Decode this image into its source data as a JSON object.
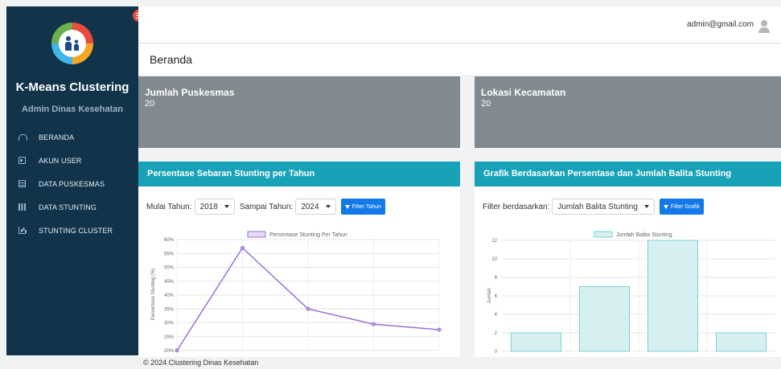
{
  "sidebar": {
    "brand_title": "K-Means Clustering",
    "brand_subtitle": "Admin Dinas Kesehatan",
    "items": [
      {
        "label": "BERANDA",
        "icon": "dashboard-icon"
      },
      {
        "label": "AKUN USER",
        "icon": "id-card-icon"
      },
      {
        "label": "DATA PUSKESMAS",
        "icon": "table-icon"
      },
      {
        "label": "DATA STUNTING",
        "icon": "grid-icon"
      },
      {
        "label": "STUNTING CLUSTER",
        "icon": "bar-chart-icon"
      }
    ]
  },
  "header": {
    "user_email": "admin@gmail.com"
  },
  "page": {
    "title": "Beranda"
  },
  "stats": [
    {
      "title": "Jumlah Puskesmas",
      "value": "20"
    },
    {
      "title": "Lokasi Kecamatan",
      "value": "20"
    }
  ],
  "left_card": {
    "title": "Persentase Sebaran Stunting per Tahun",
    "start_label": "Mulai Tahun:",
    "start_value": "2018",
    "end_label": "Sampai Tahun:",
    "end_value": "2024",
    "button_label": "Filter Tahun"
  },
  "right_card": {
    "title": "Grafik Berdasarkan Persentase dan Jumlah Balita Stunting",
    "filter_label": "Filter berdasarkan:",
    "filter_value": "Jumlah Balita Stunting",
    "button_label": "Filter Grafik"
  },
  "colors": {
    "sidebar": "#11344a",
    "accent": "#18a2b8",
    "button": "#1479e8",
    "stat_card": "#808a8f",
    "line": "#9b6fd0",
    "bar_fill": "#d6f0f1",
    "bar_stroke": "#7fcfd3"
  },
  "chart_data": [
    {
      "type": "line",
      "legend": "Persentase Stunting Per Tahun",
      "ylabel": "Persentase Stunting (%)",
      "ylim": [
        20,
        60
      ],
      "yticks": [
        "60%",
        "55%",
        "50%",
        "45%",
        "40%",
        "35%",
        "30%",
        "25%",
        "20%"
      ],
      "values": [
        20,
        57,
        35,
        29.5,
        27.5
      ]
    },
    {
      "type": "bar",
      "legend": "Jumlah Balita Stunting",
      "ylabel": "Jumlah",
      "ylim": [
        0,
        12
      ],
      "yticks": [
        "12",
        "10",
        "8",
        "6",
        "4",
        "2",
        "0"
      ],
      "values": [
        2,
        7,
        12,
        2
      ]
    }
  ],
  "footer": {
    "text": "© 2024 Clustering Dinas Kesehatan"
  }
}
